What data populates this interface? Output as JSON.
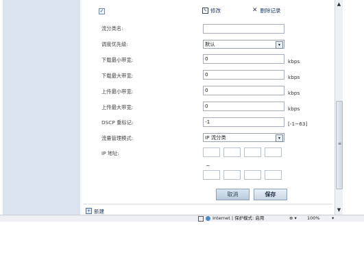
{
  "header": {
    "checkbox_mark": "✓",
    "edit_label": "修改",
    "delete_label": "删除记录"
  },
  "form": {
    "class_name": {
      "label": "流分类名:",
      "value": ""
    },
    "priority": {
      "label": "调度优先级:",
      "value": "默认"
    },
    "dl_min": {
      "label": "下载最小带宽:",
      "value": "0",
      "unit": "kbps"
    },
    "dl_max": {
      "label": "下载最大带宽:",
      "value": "0",
      "unit": "kbps"
    },
    "ul_min": {
      "label": "上传最小带宽:",
      "value": "0",
      "unit": "kbps"
    },
    "ul_max": {
      "label": "上传最大带宽:",
      "value": "0",
      "unit": "kbps"
    },
    "dscp": {
      "label": "DSCP 重标记:",
      "value": "-1",
      "range": "[-1~63]"
    },
    "mode": {
      "label": "流量管理模式:",
      "value": "IP 流分类"
    },
    "ip": {
      "label": "IP 地址:",
      "separator": "~"
    }
  },
  "buttons": {
    "cancel": "取消",
    "save": "保存"
  },
  "new_item": {
    "label": "新建"
  },
  "scrollbar": {
    "up": "▲",
    "down": "▼",
    "grip": "≡"
  },
  "statusbar": {
    "zone_text": "Internet | 保护模式: 启用",
    "zoom": "100%",
    "extra": "⊕ ▾",
    "zoom_arrow": "▾"
  },
  "icons": {
    "dropdown": "▾",
    "edit": "✎",
    "delete": "✕",
    "new": "+"
  }
}
